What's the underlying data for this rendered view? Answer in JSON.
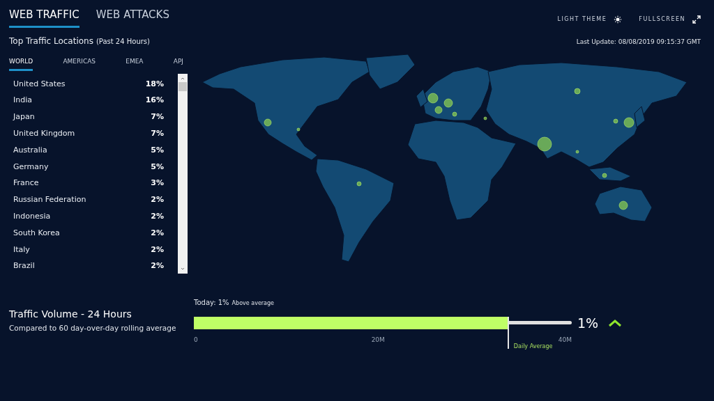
{
  "main_tabs": [
    {
      "label": "WEB TRAFFIC",
      "selected": true
    },
    {
      "label": "WEB ATTACKS",
      "selected": false
    }
  ],
  "header_actions": [
    {
      "label": "LIGHT THEME",
      "kind": "theme"
    },
    {
      "label": "FULLSCREEN",
      "kind": "fullscreen"
    }
  ],
  "section_title": {
    "text": "Top Traffic Locations",
    "note": "(Past 24 Hours)"
  },
  "last_update": "Last Update: 08/08/2019 09:15:37 GMT",
  "region_tabs": [
    {
      "label": "WORLD",
      "selected": true
    },
    {
      "label": "AMERICAS",
      "selected": false
    },
    {
      "label": "EMEA",
      "selected": false
    },
    {
      "label": "APJ",
      "selected": false
    }
  ],
  "locations": [
    {
      "country": "United States",
      "share": "18%"
    },
    {
      "country": "India",
      "share": "16%"
    },
    {
      "country": "Japan",
      "share": "7%"
    },
    {
      "country": "United Kingdom",
      "share": "7%"
    },
    {
      "country": "Australia",
      "share": "5%"
    },
    {
      "country": "Germany",
      "share": "5%"
    },
    {
      "country": "France",
      "share": "3%"
    },
    {
      "country": "Russian Federation",
      "share": "2%"
    },
    {
      "country": "Indonesia",
      "share": "2%"
    },
    {
      "country": "South Korea",
      "share": "2%"
    },
    {
      "country": "Italy",
      "share": "2%"
    },
    {
      "country": "Brazil",
      "share": "2%"
    }
  ],
  "traffic_volume": {
    "title": "Traffic Volume - 24 Hours",
    "subtitle": "Compared to 60 day-over-day rolling average",
    "today_label": "Today: 1%",
    "today_note": "Above average",
    "level": 0.83,
    "ticks": [
      "0",
      "20M",
      "40M"
    ],
    "average_label": "Daily Average",
    "change": "1%",
    "rising": true
  }
}
